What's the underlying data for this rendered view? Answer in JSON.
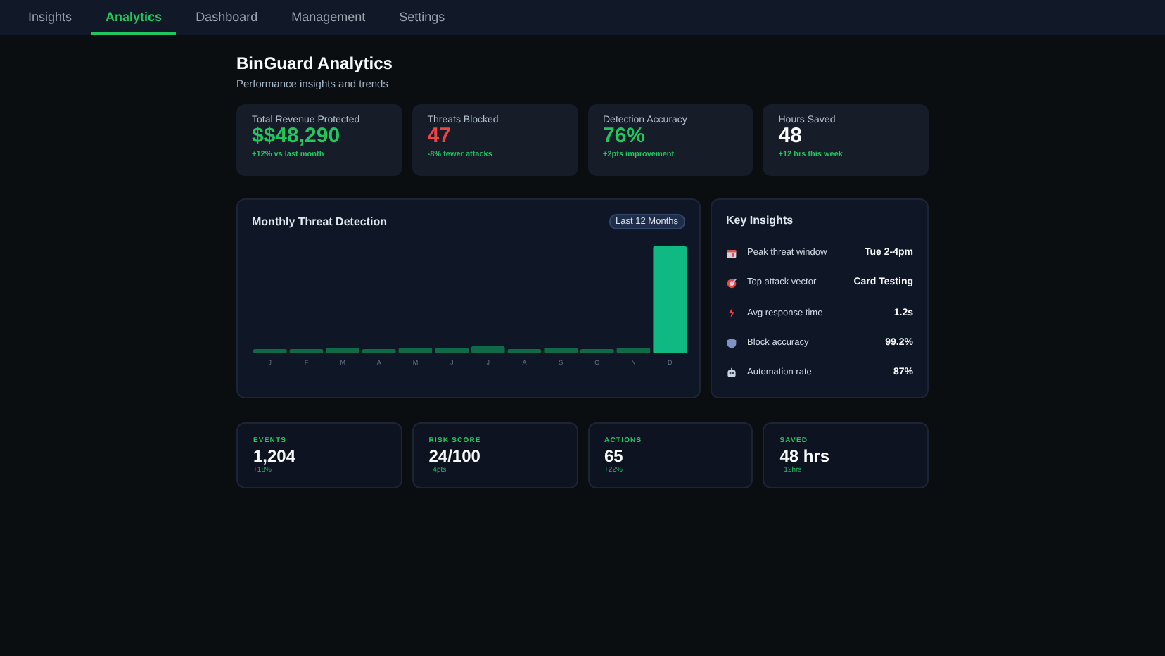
{
  "nav": {
    "tabs": [
      {
        "label": "Insights",
        "selected": false
      },
      {
        "label": "Analytics",
        "selected": true
      },
      {
        "label": "Dashboard",
        "selected": false
      },
      {
        "label": "Management",
        "selected": false
      },
      {
        "label": "Settings",
        "selected": false
      }
    ]
  },
  "header": {
    "title": "BinGuard Analytics",
    "subtitle": "Performance insights and trends"
  },
  "kpis": [
    {
      "label": "Total Revenue Protected",
      "value": "$$48,290",
      "color": "#22c55e",
      "change": "+12% vs last month"
    },
    {
      "label": "Threats Blocked",
      "value": "47",
      "color": "#ef4444",
      "change": "-8% fewer attacks"
    },
    {
      "label": "Detection Accuracy",
      "value": "76%",
      "color": "#22c55e",
      "change": "+2pts improvement"
    },
    {
      "label": "Hours Saved",
      "value": "48",
      "color": "#f8fafc",
      "change": "+12 hrs this week"
    }
  ],
  "chart": {
    "title": "Monthly Threat Detection",
    "range": "Last 12 Months",
    "months": [
      "J",
      "F",
      "M",
      "A",
      "M",
      "J",
      "J",
      "A",
      "S",
      "O",
      "N",
      "D"
    ]
  },
  "insights": {
    "title": "Key Insights",
    "rows": [
      {
        "kind": "calendar",
        "label": "Peak threat window",
        "value": "Tue 2-4pm"
      },
      {
        "kind": "target",
        "label": "Top attack vector",
        "value": "Card Testing"
      },
      {
        "kind": "bolt",
        "label": "Avg response time",
        "value": "1.2s"
      },
      {
        "kind": "shield",
        "label": "Block accuracy",
        "value": "99.2%"
      },
      {
        "kind": "robot",
        "label": "Automation rate",
        "value": "87%"
      }
    ]
  },
  "stats": [
    {
      "label": "EVENTS",
      "value": "1,204",
      "change": "+18%"
    },
    {
      "label": "RISK SCORE",
      "value": "24/100",
      "change": "+4pts"
    },
    {
      "label": "ACTIONS",
      "value": "65",
      "change": "+22%"
    },
    {
      "label": "SAVED",
      "value": "48 hrs",
      "change": "+12hrs"
    }
  ]
}
